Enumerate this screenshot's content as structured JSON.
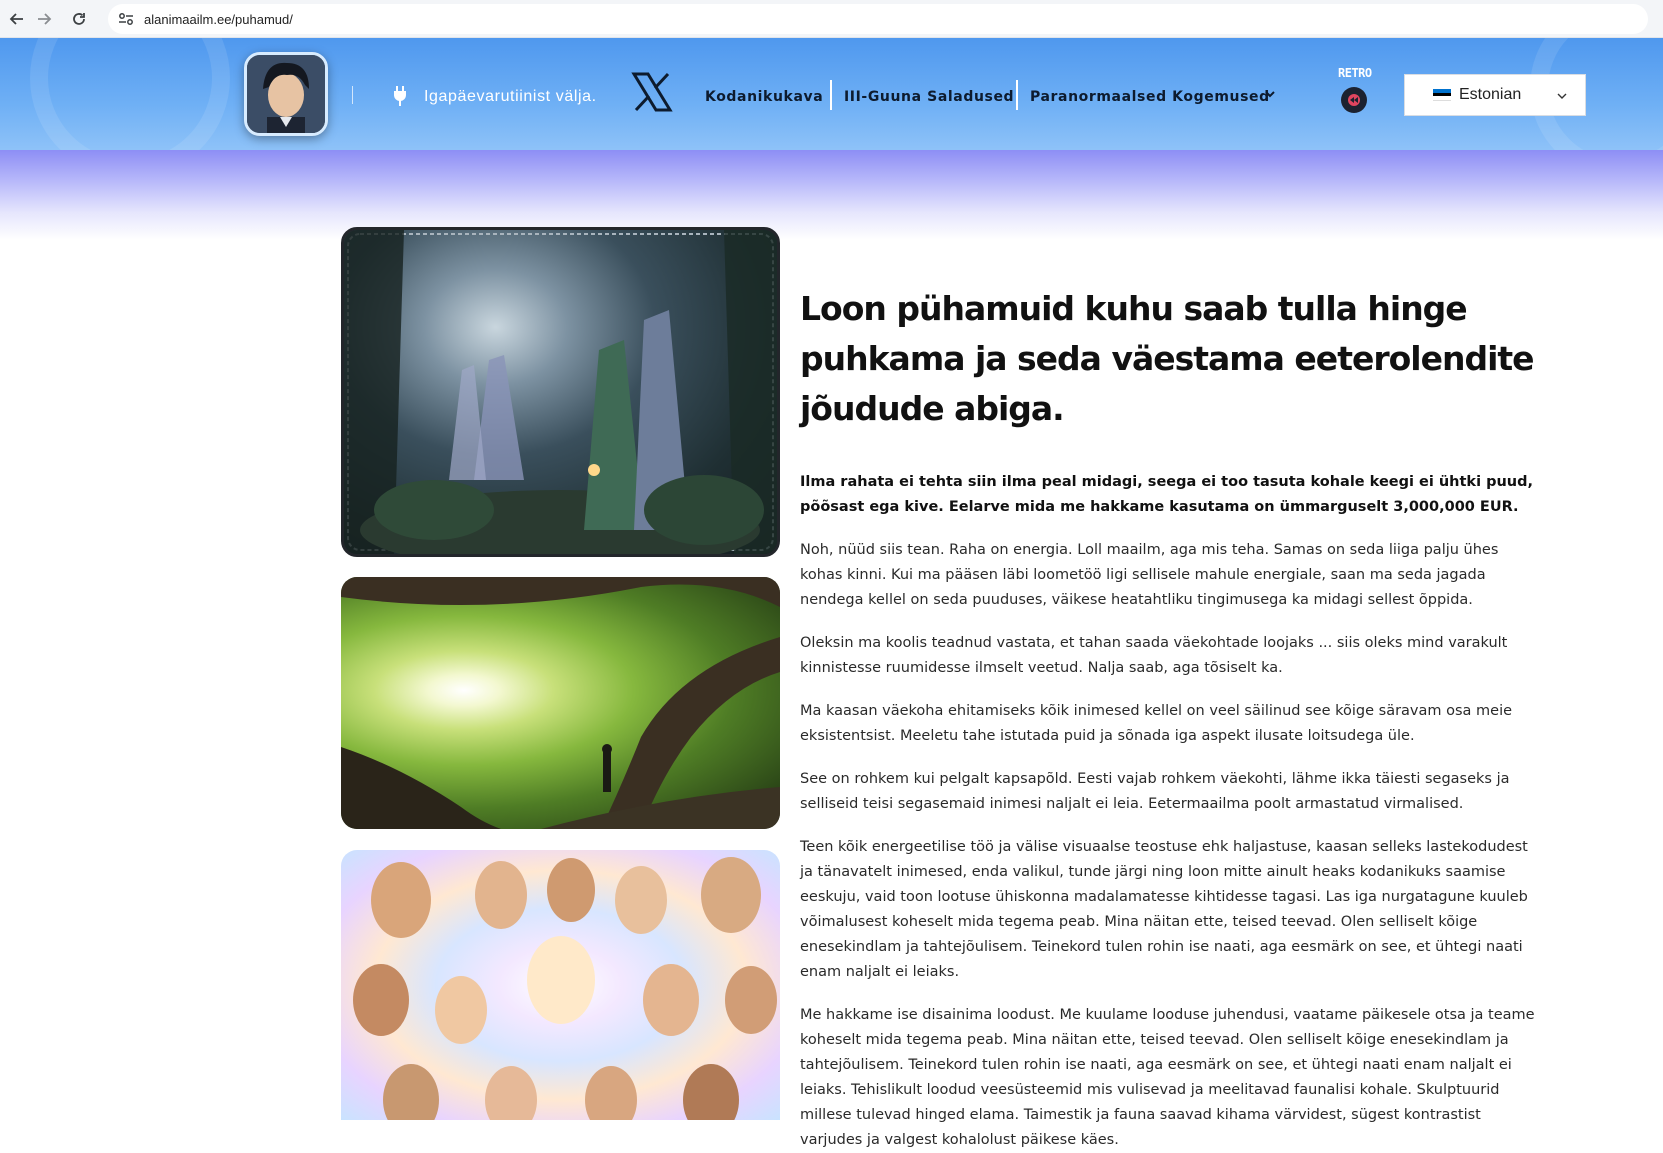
{
  "browser": {
    "url": "alanimaailm.ee/puhamud/"
  },
  "header": {
    "tagline": "Igapäevarutiinist välja.",
    "nav": [
      {
        "label": "Kodanikukava"
      },
      {
        "label": "III-Guuna Saladused"
      },
      {
        "label": "Paranormaalsed Kogemused"
      }
    ],
    "retro_label": "RETRO",
    "language": "Estonian",
    "colors": {
      "header_top": "#4f98ee",
      "header_bottom": "#8ec2f8",
      "glow": "#8d8ef5",
      "flag_blue": "#0072ce",
      "flag_black": "#000000",
      "flag_white": "#ffffff"
    }
  },
  "content": {
    "headline": "Loon pühamuid kuhu saab tulla hinge puhkama ja seda väestama eeterolendite jõudude abiga.",
    "lead": "Ilma rahata ei tehta siin ilma peal midagi, seega ei too tasuta kohale keegi ei ühtki puud, põõsast ega kive. Eelarve mida me hakkame kasutama on ümmarguselt 3,000,000 EUR.",
    "paragraphs": [
      "Noh, nüüd siis tean. Raha on energia. Loll maailm, aga mis teha. Samas on seda liiga palju ühes kohas kinni. Kui ma pääsen läbi loometöö ligi sellisele mahule energiale, saan ma seda jagada nendega kellel on seda puuduses, väikese heatahtliku tingimusega ka midagi sellest õppida.",
      "Oleksin ma koolis teadnud vastata, et tahan saada väekohtade loojaks ... siis oleks mind varakult kinnistesse ruumidesse ilmselt veetud. Nalja saab, aga tõsiselt ka.",
      "Ma kaasan väekoha ehitamiseks kõik inimesed kellel on veel säilinud see kõige säravam osa meie eksistentsist. Meeletu tahe istutada puid ja sõnada iga aspekt ilusate loitsudega üle.",
      "See on rohkem kui pelgalt kapsapõld. Eesti vajab rohkem väekohti, lähme ikka täiesti segaseks ja selliseid teisi segasemaid inimesi naljalt ei leia. Eetermaailma poolt armastatud virmalised.",
      "Teen kõik energeetilise töö ja välise visuaalse teostuse ehk haljastuse, kaasan selleks lastekodudest ja tänavatelt inimesed, enda valikul, tunde järgi ning loon mitte ainult heaks kodanikuks saamise eeskuju, vaid toon lootuse ühiskonna madalamatesse kihtidesse tagasi. Las iga nurgatagune kuuleb võimalusest koheselt mida tegema peab. Mina näitan ette, teised teevad. Olen selliselt kõige enesekindlam ja tahtejõulisem. Teinekord tulen rohin ise naati, aga eesmärk on see, et ühtegi naati enam naljalt ei leiaks.",
      "Me hakkame ise disainima loodust. Me kuulame looduse juhendusi, vaatame päikesele otsa ja teame koheselt mida tegema peab. Mina näitan ette, teised teevad. Olen selliselt kõige enesekindlam ja tahtejõulisem. Teinekord tulen rohin ise naati, aga eesmärk on see, et ühtegi naati enam naljalt ei leiaks. Tehislikult loodud veesüsteemid mis vulisevad ja meelitavad faunalisi kohale. Skulptuurid millese tulevad hinged elama. Taimestik ja fauna saavad kihama värvidest, sügest kontrastist varjudes ja valgest kohalolust päikese käes."
    ]
  }
}
